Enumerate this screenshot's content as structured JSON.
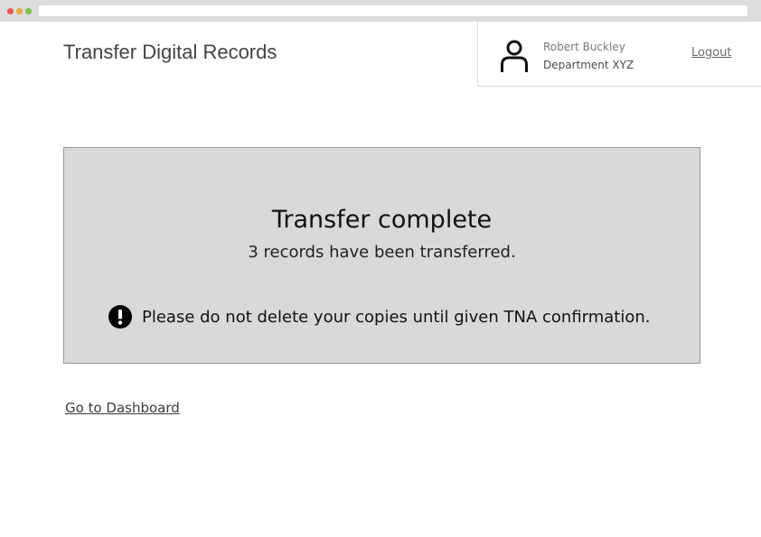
{
  "window": {
    "url": ""
  },
  "header": {
    "app_title": "Transfer Digital Records"
  },
  "user": {
    "name": "Robert Buckley",
    "department": "Department XYZ",
    "logout_label": "Logout"
  },
  "confirmation": {
    "heading": "Transfer complete",
    "summary": "3 records have been transferred.",
    "warning_icon": "exclamation-circle-icon",
    "warning": "Please do not delete your copies until given TNA confirmation."
  },
  "navigation": {
    "dashboard_link": "Go to Dashboard"
  },
  "colors": {
    "panel_background": "#d9d9d9",
    "panel_border": "#9a9a9a",
    "text_primary": "#111111"
  }
}
